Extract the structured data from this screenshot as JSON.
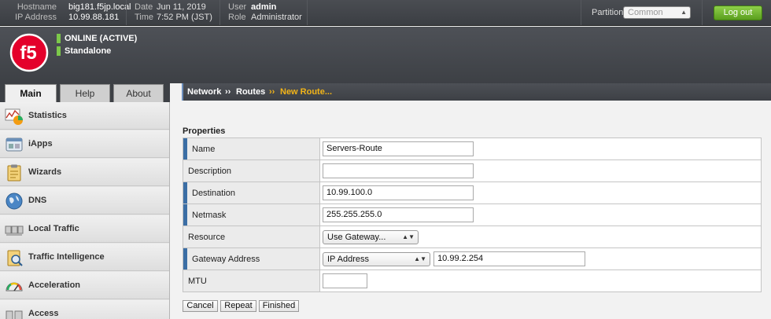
{
  "topbar": {
    "hostname_label": "Hostname",
    "hostname": "big181.f5jp.local",
    "ip_label": "IP Address",
    "ip": "10.99.88.181",
    "date_label": "Date",
    "date": "Jun 11, 2019",
    "time_label": "Time",
    "time": "7:52 PM (JST)",
    "user_label": "User",
    "user": "admin",
    "role_label": "Role",
    "role": "Administrator",
    "partition_label": "Partition:",
    "partition_value": "Common",
    "logout_label": "Log out"
  },
  "header": {
    "logo_text": "f5",
    "status": "ONLINE (ACTIVE)",
    "mode": "Standalone",
    "status_color": "#7cc84a"
  },
  "tabs": [
    {
      "label": "Main",
      "active": true
    },
    {
      "label": "Help",
      "active": false
    },
    {
      "label": "About",
      "active": false
    }
  ],
  "sidebar": {
    "items": [
      {
        "label": "Statistics",
        "icon": "statistics-icon"
      },
      {
        "label": "iApps",
        "icon": "iapps-icon"
      },
      {
        "label": "Wizards",
        "icon": "wizards-icon"
      },
      {
        "label": "DNS",
        "icon": "dns-globe-icon"
      },
      {
        "label": "Local Traffic",
        "icon": "local-traffic-icon"
      },
      {
        "label": "Traffic Intelligence",
        "icon": "traffic-intelligence-icon"
      },
      {
        "label": "Acceleration",
        "icon": "acceleration-gauge-icon"
      },
      {
        "label": "Access",
        "icon": "access-icon"
      }
    ]
  },
  "breadcrumb": {
    "items": [
      "Network",
      "Routes",
      "New Route..."
    ],
    "separator": "››",
    "current_color": "#f2b418"
  },
  "form": {
    "section_title": "Properties",
    "rows": [
      {
        "label": "Name",
        "required": true,
        "value": "Servers-Route"
      },
      {
        "label": "Description",
        "required": false,
        "value": ""
      },
      {
        "label": "Destination",
        "required": true,
        "value": "10.99.100.0"
      },
      {
        "label": "Netmask",
        "required": true,
        "value": "255.255.255.0"
      },
      {
        "label": "Resource",
        "required": false,
        "select": "Use Gateway..."
      },
      {
        "label": "Gateway Address",
        "required": true,
        "select": "IP Address",
        "value": "10.99.2.254"
      },
      {
        "label": "MTU",
        "required": false,
        "value": ""
      }
    ]
  },
  "actions": {
    "cancel": "Cancel",
    "repeat": "Repeat",
    "finished": "Finished"
  }
}
